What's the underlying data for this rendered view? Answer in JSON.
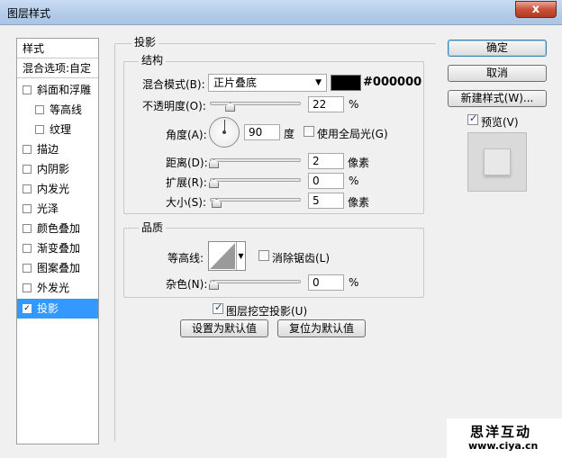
{
  "window": {
    "title": "图层样式",
    "close_glyph": "x"
  },
  "style_list": {
    "header": "样式",
    "blend_options": "混合选项:自定",
    "items": [
      {
        "label": "斜面和浮雕",
        "checked": false
      },
      {
        "label": "等高线",
        "checked": false,
        "indent": true
      },
      {
        "label": "纹理",
        "checked": false,
        "indent": true
      },
      {
        "label": "描边",
        "checked": false
      },
      {
        "label": "内阴影",
        "checked": false
      },
      {
        "label": "内发光",
        "checked": false
      },
      {
        "label": "光泽",
        "checked": false
      },
      {
        "label": "颜色叠加",
        "checked": false
      },
      {
        "label": "渐变叠加",
        "checked": false
      },
      {
        "label": "图案叠加",
        "checked": false
      },
      {
        "label": "外发光",
        "checked": false
      },
      {
        "label": "投影",
        "checked": true,
        "selected": true
      }
    ]
  },
  "drop_shadow": {
    "title": "投影",
    "structure": {
      "title": "结构",
      "blend_mode_label": "混合模式(B):",
      "blend_mode_value": "正片叠底",
      "color_hex": "#000000",
      "opacity_label": "不透明度(O):",
      "opacity_value": "22",
      "opacity_fraction": 0.22,
      "opacity_unit": "%",
      "angle_label": "角度(A):",
      "angle_value": "90",
      "angle_unit": "度",
      "global_light_label": "使用全局光(G)",
      "global_light_checked": false,
      "distance_label": "距离(D):",
      "distance_value": "2",
      "distance_unit": "像素",
      "spread_label": "扩展(R):",
      "spread_value": "0",
      "spread_unit": "%",
      "size_label": "大小(S):",
      "size_value": "5",
      "size_unit": "像素"
    },
    "quality": {
      "title": "品质",
      "contour_label": "等高线:",
      "antialias_label": "消除锯齿(L)",
      "antialias_checked": false,
      "noise_label": "杂色(N):",
      "noise_value": "0",
      "noise_unit": "%"
    },
    "knockout_label": "图层挖空投影(U)",
    "knockout_checked": true,
    "make_default_label": "设置为默认值",
    "reset_default_label": "复位为默认值"
  },
  "buttons": {
    "ok": "确定",
    "cancel": "取消",
    "new_style": "新建样式(W)...",
    "preview_label": "预览(V)",
    "preview_checked": true
  },
  "watermark": {
    "brand": "思洋互动",
    "url": "www.ciya.cn"
  },
  "colors": {
    "selected_bg": "#3399ff",
    "swatch": "#000000"
  }
}
